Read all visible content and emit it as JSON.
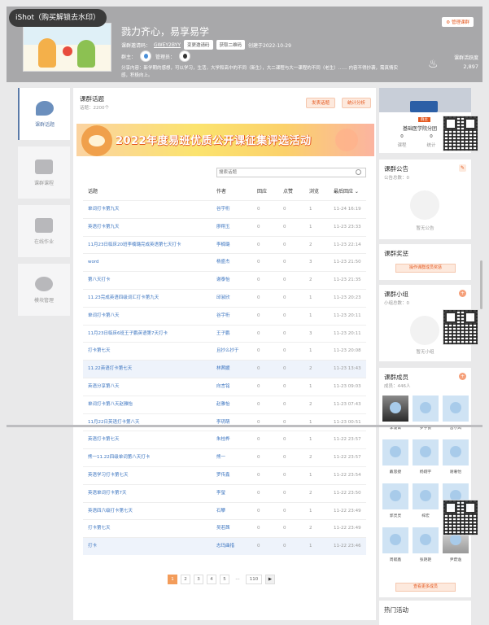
{
  "watermark": "iShot（购买解锁去水印）",
  "header": {
    "title": "戮力齐心，易享易学",
    "code_label": "课群邀请码：",
    "code_value": "GWEY2BYY",
    "change_code": "变更邀请码",
    "qr_btn": "获取二维码",
    "created": "创建于2022-10-29",
    "owner_label": "群主：",
    "admin_label": "管理员：",
    "share": "分享内容：新学期的感想，可以学习，生活，大学和高中的不同（新生），大二课程与大一课程的不同（老生）…… 内容不得抄袭，需真情实感，积极向上。",
    "manage_btn": "管理课群",
    "activity_label": "课群活跃度",
    "activity_value": "2,897"
  },
  "nav": [
    {
      "label": "课群话题",
      "icon": "chat-bubbles-icon"
    },
    {
      "label": "课群课程",
      "icon": "book-icon"
    },
    {
      "label": "在线作业",
      "icon": "clipboard-icon"
    },
    {
      "label": "模块管理",
      "icon": "gear-icon"
    }
  ],
  "main": {
    "title": "课群话题",
    "count": "话题：2200个",
    "publish_btn": "发表话题",
    "stats_btn": "统计分析",
    "banner": "2022年度易班优质公开课征集评选活动",
    "search_placeholder": "搜索话题",
    "columns": [
      "话题",
      "作者",
      "回应",
      "点赞",
      "浏览",
      "最后回应 ⌄"
    ],
    "rows": [
      [
        "单词打卡第九天",
        "谷宇桁",
        "0",
        "0",
        "1",
        "11-24 16:19"
      ],
      [
        "英语打卡第九天",
        "廖翔玉",
        "0",
        "0",
        "1",
        "11-23 23:33"
      ],
      [
        "11月23日临床20班李楠璐完成英语第七天打卡",
        "李楠璐",
        "0",
        "0",
        "2",
        "11-23 22:14"
      ],
      [
        "word",
        "杨盛杰",
        "0",
        "0",
        "3",
        "11-23 21:50"
      ],
      [
        "第八天打卡",
        "谢泰怡",
        "0",
        "0",
        "2",
        "11-23 21:35"
      ],
      [
        "11.23完成英语四级词汇打卡第九天",
        "邱淑欣",
        "0",
        "0",
        "1",
        "11-23 20:23"
      ],
      [
        "单词打卡第八天",
        "谷宇桁",
        "0",
        "0",
        "1",
        "11-23 20:11"
      ],
      [
        "11月23日临床6班王子鹏英语第7天打卡",
        "王子鹏",
        "0",
        "0",
        "3",
        "11-23 20:11"
      ],
      [
        "打卡第七天",
        "且抄么抄于",
        "0",
        "0",
        "1",
        "11-23 20:08"
      ],
      [
        "11.22英语打卡第七天",
        "林茜媛",
        "0",
        "0",
        "2",
        "11-23 13:43"
      ],
      [
        "英语分享第八天",
        "向言铭",
        "0",
        "0",
        "1",
        "11-23 09:03"
      ],
      [
        "单词打卡第八天赵雅怡",
        "赵雅怡",
        "0",
        "0",
        "2",
        "11-23 07:43"
      ],
      [
        "11月22日英语打卡第八天",
        "李玥萌",
        "0",
        "0",
        "1",
        "11-23 00:51"
      ],
      [
        "英语打卡第七天",
        "朱桂桦",
        "0",
        "0",
        "1",
        "11-22 23:57"
      ],
      [
        "熊一11.22四级单词第八天打卡",
        "熊一",
        "0",
        "0",
        "2",
        "11-22 23:57"
      ],
      [
        "英语学习打卡第七天",
        "罗传鑫",
        "0",
        "0",
        "1",
        "11-22 23:54"
      ],
      [
        "英语单词打卡第7天",
        "李瑩",
        "0",
        "0",
        "2",
        "11-22 23:50"
      ],
      [
        "英语四六级打卡第七天",
        "石攀",
        "0",
        "0",
        "1",
        "11-22 23:49"
      ],
      [
        "打卡第七天",
        "吴若茜",
        "0",
        "0",
        "2",
        "11-22 23:49"
      ],
      [
        "打卡",
        "志玛曲措",
        "0",
        "0",
        "1",
        "11-22 23:46"
      ]
    ],
    "pages": [
      "1",
      "2",
      "3",
      "4",
      "5",
      "…",
      "110",
      "▶"
    ]
  },
  "right": {
    "college": "基础医学院分团",
    "college_tag": "群主",
    "courses": {
      "value": "0",
      "label": "课程"
    },
    "stats": {
      "value": "0",
      "label": "统计"
    },
    "notice_title": "课群公告",
    "notice_count": "公告总数：0",
    "notice_empty": "暂无公告",
    "award_title": "课群奖惩",
    "award_btn": "操作课群成员奖惩",
    "group_title": "课群小组",
    "group_count": "小组总数：0",
    "group_empty": "暂无小组",
    "members_title": "课群成员",
    "members_count": "成员：446人",
    "members": [
      "李凌霄",
      "罗学良",
      "晋小风",
      "戴思捷",
      "杨翔宇",
      "谢奢怡",
      "郭灵灵",
      "梓宏",
      "",
      "周毓鑫",
      "张艳艳",
      "尹蔚逸"
    ],
    "members_btn": "查看更多成员",
    "hot_title": "热门活动"
  }
}
